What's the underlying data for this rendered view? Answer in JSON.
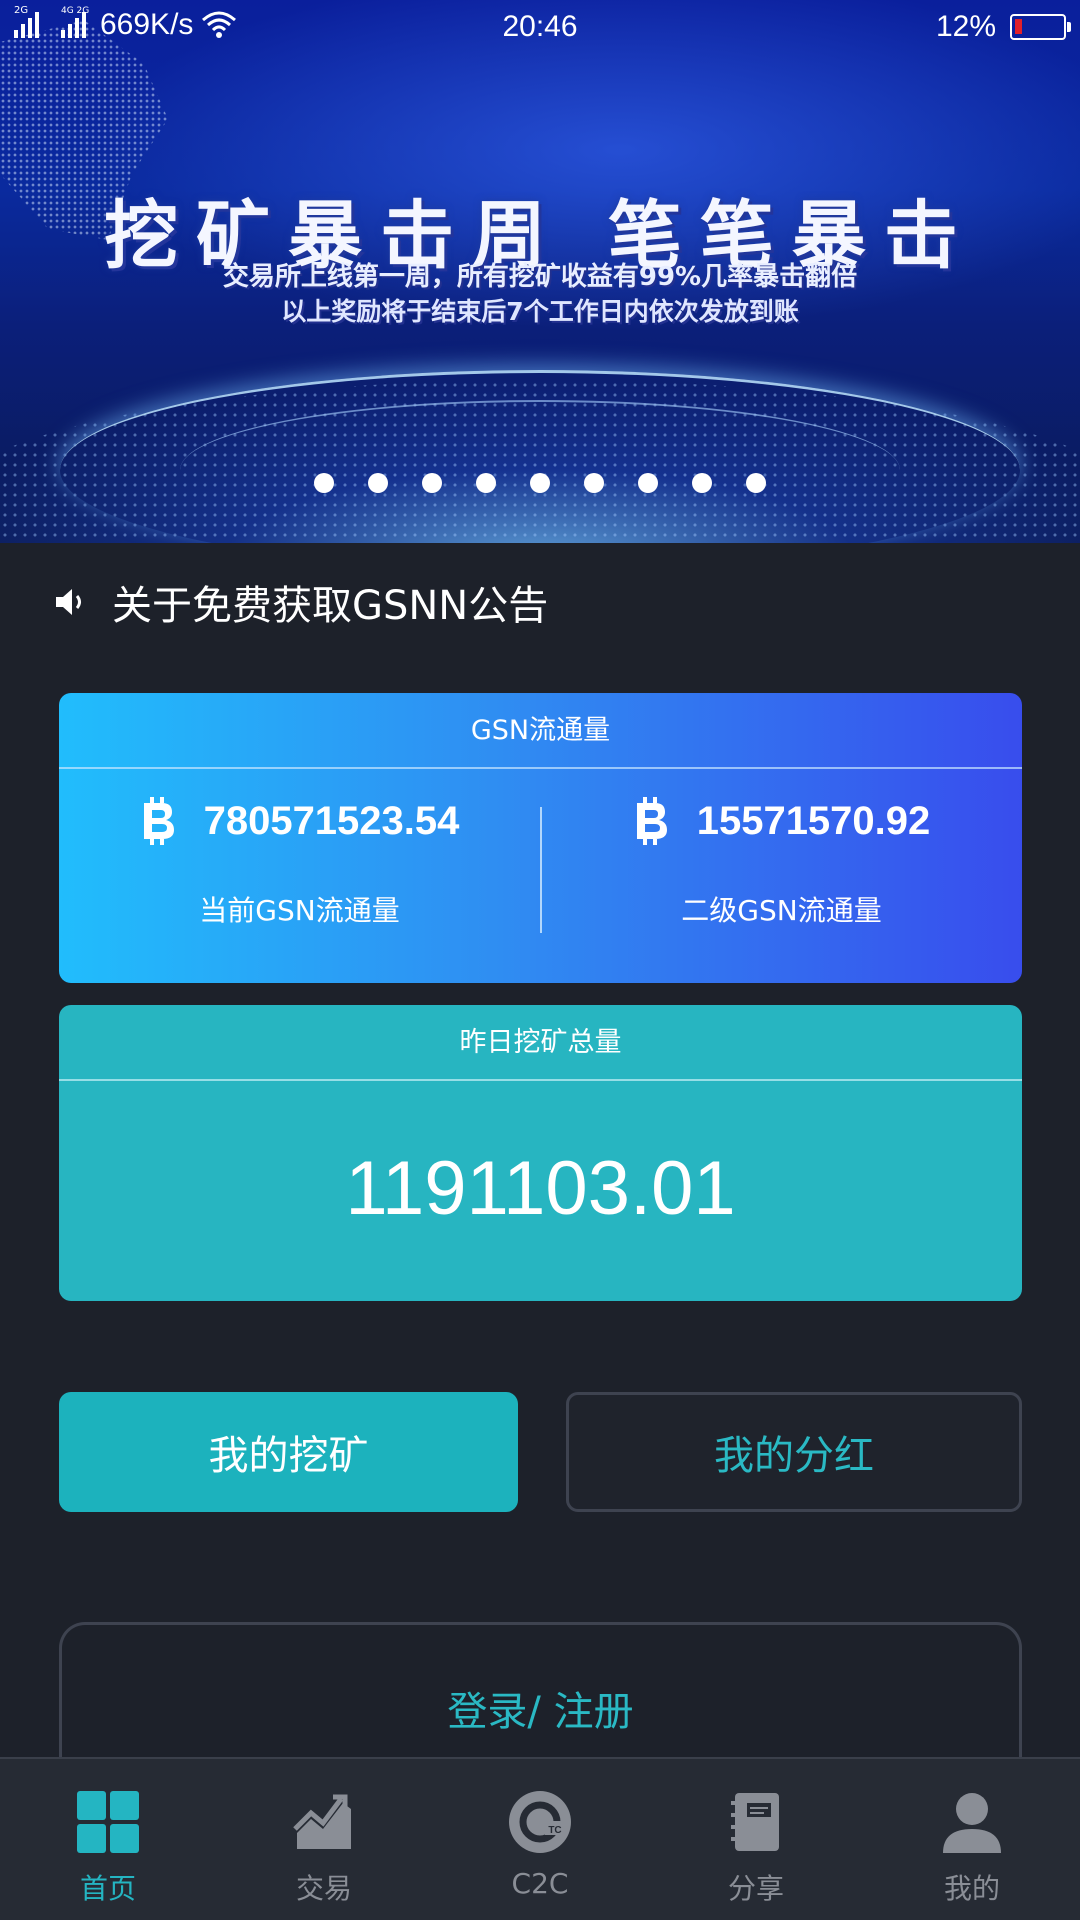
{
  "status_bar": {
    "net_tag_1": "2G",
    "net_tag_2": "4G 2G",
    "speed": "669K/s",
    "time": "20:46",
    "battery": "12%"
  },
  "banner": {
    "title": "挖矿暴击周  笔笔暴击",
    "line1": "交易所上线第一周，所有挖矿收益有99%几率暴击翻倍",
    "line2": "以上奖励将于结束后7个工作日内依次发放到账",
    "slide_count": 9
  },
  "notice": {
    "text": "关于免费获取GSNN公告"
  },
  "circulation_card": {
    "title": "GSN流通量",
    "current_value": "780571523.54",
    "current_label": "当前GSN流通量",
    "secondary_value": "15571570.92",
    "secondary_label": "二级GSN流通量"
  },
  "mining_card": {
    "title": "昨日挖矿总量",
    "value": "1191103.01"
  },
  "actions": {
    "my_mining": "我的挖矿",
    "my_dividend": "我的分红"
  },
  "login": {
    "label": "登录/ 注册"
  },
  "tabbar": {
    "tabs": [
      {
        "label": "首页",
        "icon": "home-grid-icon",
        "active": true
      },
      {
        "label": "交易",
        "icon": "trade-chart-icon",
        "active": false
      },
      {
        "label": "C2C",
        "icon": "c2c-coin-icon",
        "active": false
      },
      {
        "label": "分享",
        "icon": "share-notebook-icon",
        "active": false
      },
      {
        "label": "我的",
        "icon": "user-profile-icon",
        "active": false
      }
    ]
  },
  "colors": {
    "background": "#1d212a",
    "accent": "#24b5c2",
    "card_gradient_start": "#21bdfc",
    "card_gradient_end": "#384ded",
    "mining_card": "#27b5c1",
    "tab_inactive": "#8a8e96"
  }
}
